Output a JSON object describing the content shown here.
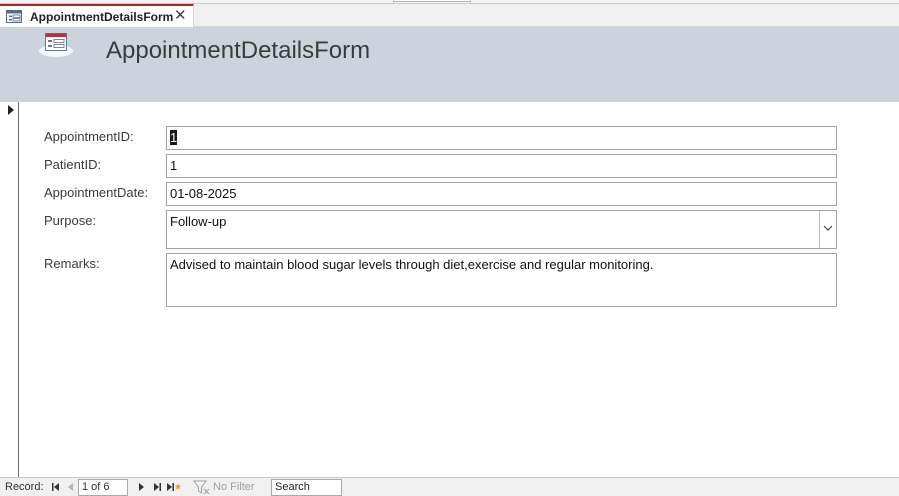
{
  "tab": {
    "label": "AppointmentDetailsForm",
    "close": "✕"
  },
  "header": {
    "title": "AppointmentDetailsForm"
  },
  "fields": {
    "appointment_id": {
      "label": "AppointmentID:",
      "value_first": "1",
      "value_rest": ""
    },
    "patient_id": {
      "label": "PatientID:",
      "value": "1"
    },
    "appointment_date": {
      "label": "AppointmentDate:",
      "value": "01-08-2025"
    },
    "purpose": {
      "label": "Purpose:",
      "value": "Follow-up"
    },
    "remarks": {
      "label": "Remarks:",
      "value": "Advised to maintain blood sugar levels through diet,exercise and regular monitoring."
    }
  },
  "navigation": {
    "record_label": "Record:",
    "current": "1 of 6",
    "filter_label": "No Filter",
    "search_value": "Search"
  },
  "colors": {
    "accent": "#a4262c",
    "header_bg": "#cdd3dc"
  },
  "icons": [
    "form-icon",
    "close-icon",
    "record-selector-arrow-icon",
    "chevron-down-icon",
    "first-record-icon",
    "previous-record-icon",
    "next-record-icon",
    "last-record-icon",
    "new-record-icon",
    "filter-icon"
  ]
}
